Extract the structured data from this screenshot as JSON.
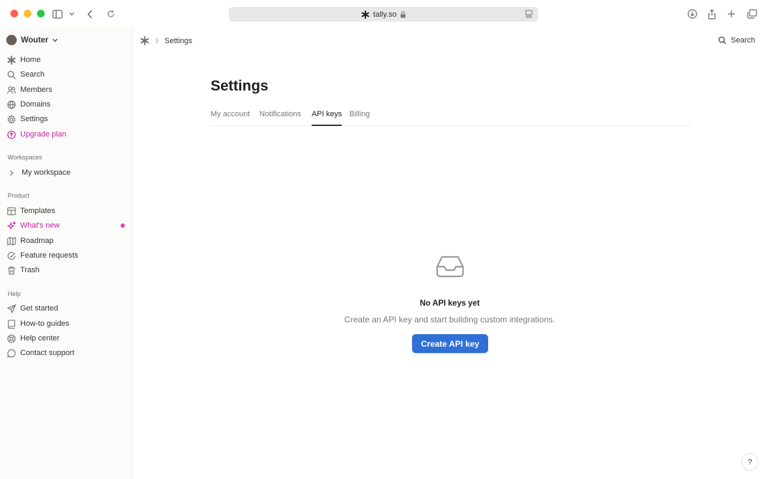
{
  "browser": {
    "url": "tally.so"
  },
  "sidebar": {
    "user_name": "Wouter",
    "primary": [
      {
        "label": "Home",
        "icon": "asterisk-icon"
      },
      {
        "label": "Search",
        "icon": "search-icon"
      },
      {
        "label": "Members",
        "icon": "users-icon"
      },
      {
        "label": "Domains",
        "icon": "globe-icon"
      },
      {
        "label": "Settings",
        "icon": "gear-icon"
      },
      {
        "label": "Upgrade plan",
        "icon": "upgrade-icon"
      }
    ],
    "workspaces_heading": "Workspaces",
    "workspace_item": "My workspace",
    "product_heading": "Product",
    "product": [
      {
        "label": "Templates",
        "icon": "templates-icon"
      },
      {
        "label": "What's new",
        "icon": "sparkle-icon"
      },
      {
        "label": "Roadmap",
        "icon": "map-icon"
      },
      {
        "label": "Feature requests",
        "icon": "feature-icon"
      },
      {
        "label": "Trash",
        "icon": "trash-icon"
      }
    ],
    "help_heading": "Help",
    "help": [
      {
        "label": "Get started",
        "icon": "send-icon"
      },
      {
        "label": "How-to guides",
        "icon": "book-icon"
      },
      {
        "label": "Help center",
        "icon": "lifebuoy-icon"
      },
      {
        "label": "Contact support",
        "icon": "chat-icon"
      }
    ]
  },
  "topbar": {
    "breadcrumb": "Settings",
    "search_label": "Search"
  },
  "main": {
    "title": "Settings",
    "tabs": [
      {
        "label": "My account",
        "active": false
      },
      {
        "label": "Notifications",
        "active": false
      },
      {
        "label": "API keys",
        "active": true
      },
      {
        "label": "Billing",
        "active": false
      }
    ],
    "empty_title": "No API keys yet",
    "empty_subtitle": "Create an API key and start building custom integrations.",
    "create_button": "Create API key"
  },
  "help_button": "?",
  "colors": {
    "accent_pink": "#c2279f",
    "primary_button": "#2f6fd6",
    "notification_dot": "#e03cc5"
  }
}
